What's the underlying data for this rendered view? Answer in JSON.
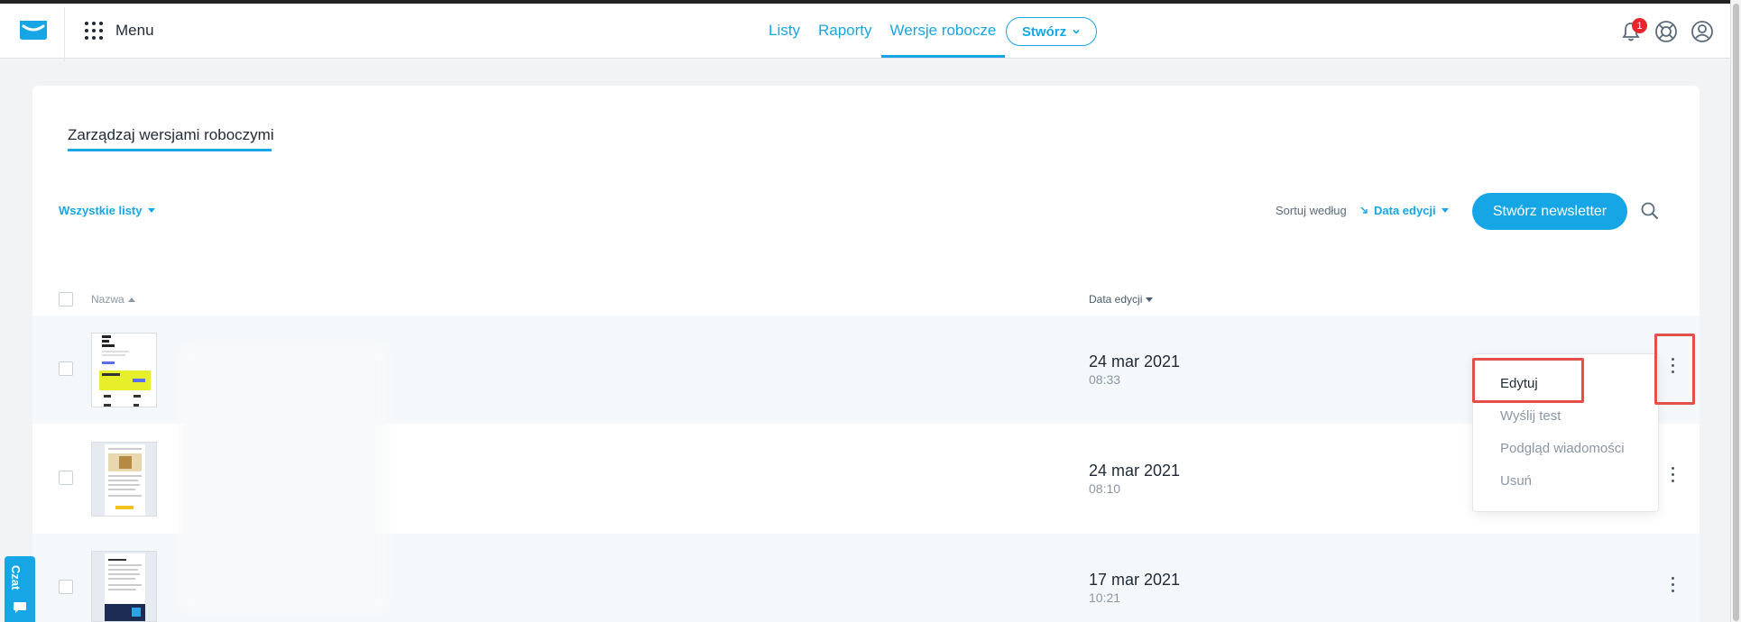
{
  "topbar": {
    "menu_label": "Menu",
    "nav": [
      "Listy",
      "Raporty",
      "Wersje robocze"
    ],
    "active_nav": "Wersje robocze",
    "create_label": "Stwórz",
    "notification_count": "1"
  },
  "page": {
    "title": "Zarządzaj wersjami roboczymi",
    "filter_label": "Wszystkie listy",
    "sort_label": "Sortuj według",
    "sort_value": "Data edycji",
    "new_newsletter_label": "Stwórz newsletter"
  },
  "table": {
    "col_name": "Nazwa",
    "col_date": "Data edycji",
    "rows": [
      {
        "date": "24 mar 2021",
        "time": "08:33"
      },
      {
        "date": "24 mar 2021",
        "time": "08:10"
      },
      {
        "date": "17 mar 2021",
        "time": "10:21"
      }
    ]
  },
  "row_menu": {
    "items": [
      "Edytuj",
      "Wyślij test",
      "Podgląd wiadomości",
      "Usuń"
    ]
  },
  "chat": {
    "label": "Czat"
  },
  "colors": {
    "accent": "#16a6e6",
    "highlight": "#e3504a",
    "badge": "#e8252a"
  }
}
